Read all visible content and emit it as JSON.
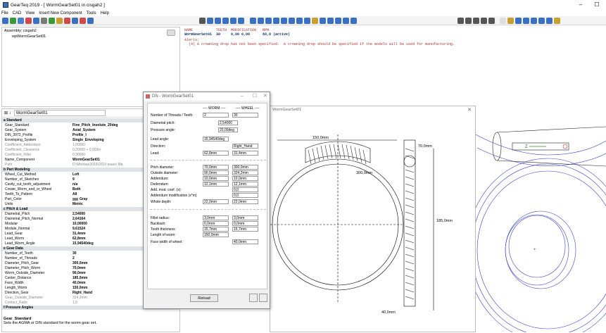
{
  "window": {
    "title": "GearTeq 2019 - [ WormGearSet01 in cisgah2 ]",
    "minimize": "–",
    "close": "☐"
  },
  "menu": [
    "File",
    "CAD",
    "View",
    "Insert New Component",
    "Tools",
    "Help"
  ],
  "assembly": {
    "root": "Assembly: cisgah2",
    "child": "wpWormGearSet01"
  },
  "console": {
    "header": "NAME           TEETH  MODIFICATION   RPM",
    "row": "WormGearSet01  30     0,00 0,00      60,0 (active)",
    "alerts_label": "Alerts:",
    "alert": "  (4) A crowning drop has not been specified.  A crowning drop should be specified if the models will be used for manufacturing."
  },
  "props": {
    "search": "WormGearSet01",
    "rows": [
      {
        "k": "a Standard",
        "cat": true
      },
      {
        "k": "Gear_Standard",
        "v": "Fine_Pitch_Involute_20deg"
      },
      {
        "k": "Gear_System",
        "v": "Axial_System"
      },
      {
        "k": "DIN_3972_Profile",
        "v": "Profile_I"
      },
      {
        "k": "Enveloping_System",
        "v": "Single_Enveloping"
      },
      {
        "k": "Coefficient_Addendum",
        "v": "1,00000",
        "gray": true
      },
      {
        "k": "Coefficient_Clearance",
        "v": "0,20000 + 0,002in",
        "gray": true
      },
      {
        "k": "Coefficient_Fillet",
        "v": "0,30000",
        "gray": true
      },
      {
        "k": "Name_Component",
        "v": "WormGearSet01"
      },
      {
        "k": "Path",
        "v": "D:\\Montaa\\2019\\2019 teaas\\ Ma",
        "gray": true
      },
      {
        "k": "b Part Modeling",
        "cat": true
      },
      {
        "k": "Wheel_Cut_Method",
        "v": "Loft"
      },
      {
        "k": "Number_of_Sketches",
        "v": "9"
      },
      {
        "k": "Cavity_cut_tooth_adjustment",
        "v": "n/a"
      },
      {
        "k": "Create_Worm_and_or_Wheel",
        "v": "Both"
      },
      {
        "k": "Teeth_To_Pattern",
        "v": "All"
      },
      {
        "k": "Part_Color",
        "v": "Gray",
        "swatch": true
      },
      {
        "k": "Units",
        "v": "Metric"
      },
      {
        "k": "c Pitch & Lead",
        "cat": true
      },
      {
        "k": "Diametral_Pitch",
        "v": "2,54000"
      },
      {
        "k": "Diametral_Pitch_Normal",
        "v": "2,64164"
      },
      {
        "k": "Modular",
        "v": "10,00000"
      },
      {
        "k": "Module_Normal",
        "v": "9,61524"
      },
      {
        "k": "Lead_Gear",
        "v": "31,4mm"
      },
      {
        "k": "Lead_Worm",
        "v": "62,8mm"
      },
      {
        "k": "Lead_Worm_Angle",
        "v": "15,94540deg"
      },
      {
        "k": "e Gear Data",
        "cat": true
      },
      {
        "k": "Number_of_Teeth",
        "v": "30"
      },
      {
        "k": "Number_of_Threads",
        "v": "2"
      },
      {
        "k": "Diameter_Pitch_Gear",
        "v": "300,0mm"
      },
      {
        "k": "Diameter_Pitch_Worm",
        "v": "70,0mm"
      },
      {
        "k": "Worm_Outside_Diameter",
        "v": "90,0mm"
      },
      {
        "k": "Center_Distance",
        "v": "185,0mm"
      },
      {
        "k": "Face_Width",
        "v": "40,0mm"
      },
      {
        "k": "Length_Worm",
        "v": "150,0mm"
      },
      {
        "k": "Direction_Gear",
        "v": "Right_Hand"
      },
      {
        "k": "Gear_Outside_Diameter",
        "v": "324,2mm",
        "gray": true
      },
      {
        "k": "Contact_Ratio",
        "v": "1,0",
        "gray": true
      },
      {
        "k": "f Pressure Angles",
        "cat": true
      }
    ],
    "desc_title": "Gear_Standard",
    "desc_text": "Sets the AGMA or DIN standard for the worm gear set."
  },
  "dialog": {
    "title": "DN - WormGearSet01",
    "worm_header": "---- WORM ----",
    "wheel_header": "---- WHEEL ----",
    "threads_label": "Number of Threads / Teeth:",
    "threads": "2",
    "teeth": "30",
    "dp_label": "Diametral pitch:",
    "dp": "2,54000",
    "pa_label": "Pressure angle:",
    "pa": "20,00deg",
    "la_label": "Lead angle:",
    "la": "15,94540deg",
    "dir_label": "Direction:",
    "dir": "Right_Hand",
    "lead_label": "Lead:",
    "lead_worm": "62,8mm",
    "lead_wheel": "31,4mm",
    "pd_label": "Pitch diameter:",
    "pd_worm": "70,0mm",
    "pd_wheel": "300,0mm",
    "od_label": "Outside diameter:",
    "od_worm": "90,0mm",
    "od_wheel": "324,2mm",
    "add_label": "Addendum:",
    "add_worm": "10,0mm",
    "add_wheel": "10,0mm",
    "ded_label": "Dedendum:",
    "ded_worm": "12,1mm",
    "ded_wheel": "12,1mm",
    "amc_label": "Add. mod. coef. (x):",
    "amc": "0,0",
    "am_label": "Addendum modification (x*m)",
    "am": "0,0",
    "wd_label": "Whole depth:",
    "wd_worm": "22,0mm",
    "wd_wheel": "22,0mm",
    "fr_label": "Fillet radius:",
    "fr_worm": "3,0mm",
    "fr_wheel": "3,0mm",
    "bl_label": "Backlash:",
    "bl_worm": "0,0mm",
    "bl_wheel": "0,0mm",
    "tt_label": "Tooth thickness:",
    "tt_worm": "15,7mm",
    "tt_wheel": "15,7mm",
    "lw_label": "Length of worm:",
    "lw": "150,0mm",
    "fw_label": "Face width of wheel:",
    "fw": "40,0mm",
    "reload": "Reload"
  },
  "drawing": {
    "title": "WormGearSet01",
    "dim_length": "150,0mm",
    "dim_od_worm": "70,0mm",
    "dim_pitch": "300,0mm",
    "dim_center": "185,0mm",
    "dim_face": "40,0mm",
    "axis_label": "Z"
  }
}
